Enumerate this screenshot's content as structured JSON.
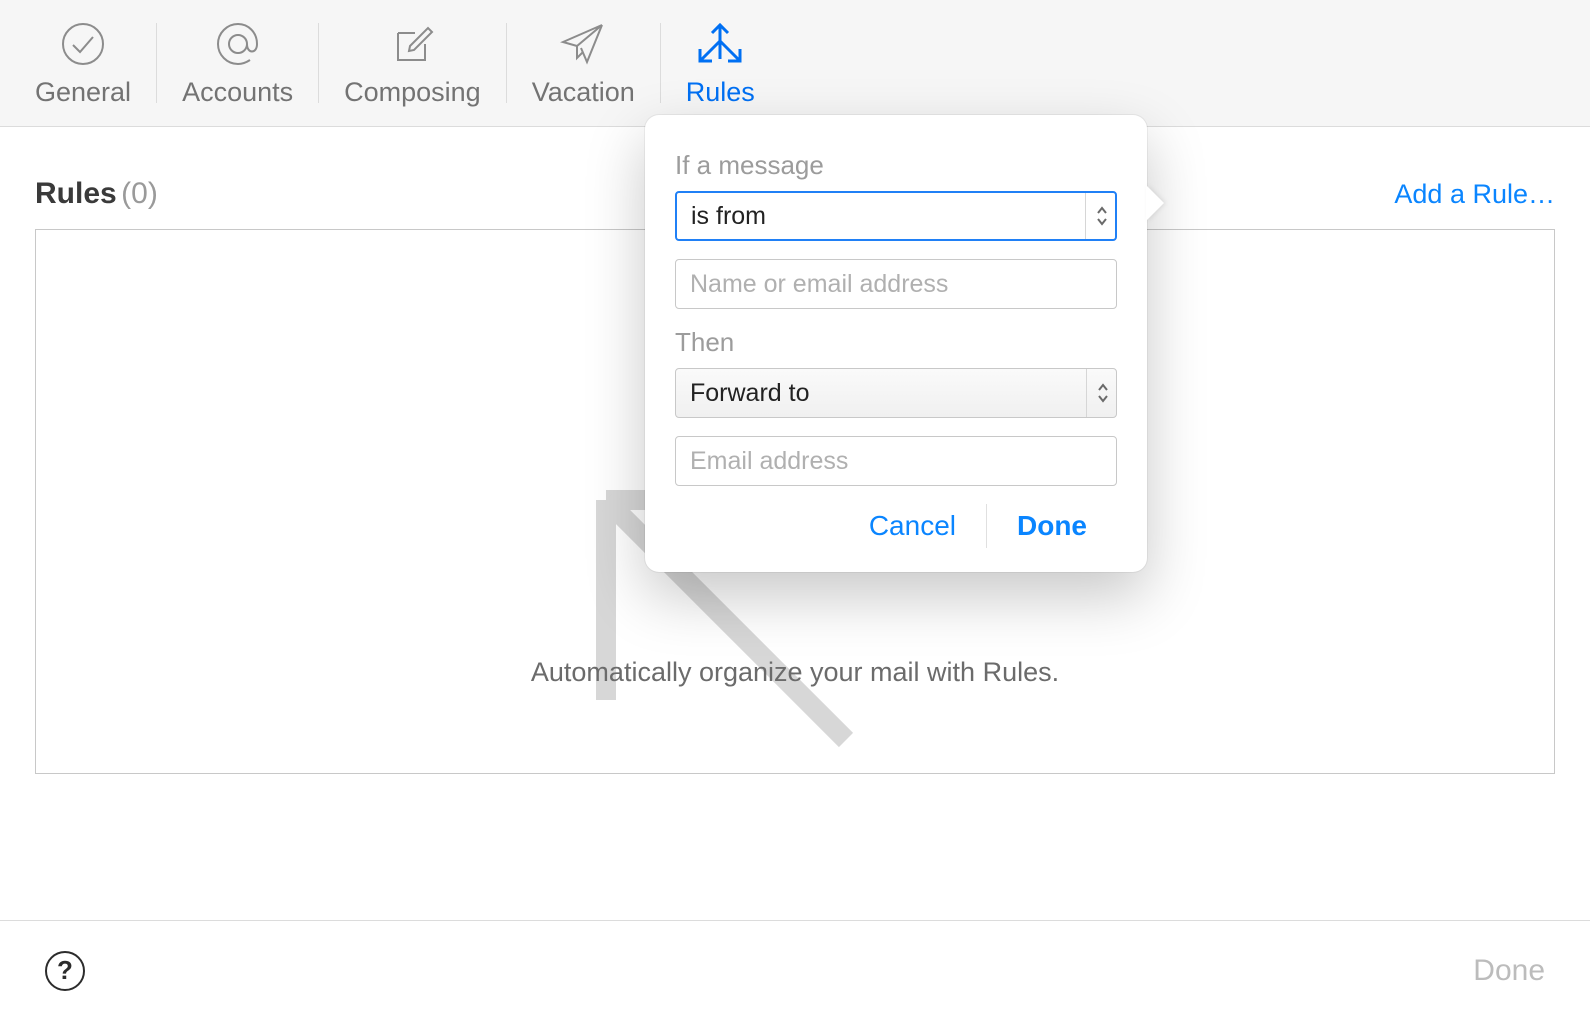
{
  "tabs": {
    "general": "General",
    "accounts": "Accounts",
    "composing": "Composing",
    "vacation": "Vacation",
    "rules": "Rules"
  },
  "section": {
    "title": "Rules",
    "count": "(0)",
    "add_link": "Add a Rule…",
    "empty_message": "Automatically organize your mail with Rules."
  },
  "popover": {
    "if_label": "If a message",
    "condition_value": "is from",
    "condition_input_placeholder": "Name or email address",
    "then_label": "Then",
    "action_value": "Forward to",
    "action_input_placeholder": "Email address",
    "cancel": "Cancel",
    "done": "Done"
  },
  "footer": {
    "help": "?",
    "done": "Done"
  }
}
